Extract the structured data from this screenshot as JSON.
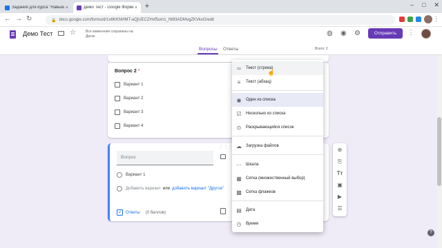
{
  "browser": {
    "tabs": [
      {
        "title": "Задания для курса \"Навыки Go",
        "favicon_color": "#1a73e8"
      },
      {
        "title": "Демо Тест - Google Формы",
        "favicon_color": "#673ab7"
      }
    ],
    "url": "docs.google.com/forms/d/1x6KKNHMT-aQjUECZHvf5um1_Nt93ADMvgZKVkxG/edit",
    "new_tab": "+",
    "close": "×"
  },
  "header": {
    "title": "Демо Тест",
    "saved_status": "Все изменения сохранены на Диске",
    "send_label": "Отправить",
    "tabs": {
      "questions": "Вопросы",
      "answers": "Ответы"
    },
    "total": "Всего: 2",
    "accent": "#673ab7"
  },
  "question2": {
    "title": "Вопрос 2",
    "required_mark": "*",
    "options": [
      "Вариант 1",
      "Вариант 2",
      "Вариант 3",
      "Вариант 4"
    ]
  },
  "new_question": {
    "placeholder": "Вопрос",
    "option1": "Вариант 1",
    "add_option": "Добавить вариант",
    "or": "или",
    "add_other": "добавить вариант \"Другое\"",
    "answers_label": "Ответы",
    "points": "(0 баллов)"
  },
  "menu": {
    "items": [
      {
        "label": "Текст (строка)",
        "icon": "short-text-icon"
      },
      {
        "label": "Текст (абзац)",
        "icon": "paragraph-icon"
      },
      {
        "label": "Один из списка",
        "icon": "radio-icon"
      },
      {
        "label": "Несколько из списка",
        "icon": "checkbox-icon"
      },
      {
        "label": "Раскрывающийся список",
        "icon": "dropdown-icon"
      },
      {
        "label": "Загрузка файлов",
        "icon": "upload-icon"
      },
      {
        "label": "Шкала",
        "icon": "scale-icon"
      },
      {
        "label": "Сетка (множественный выбор)",
        "icon": "grid-icon"
      },
      {
        "label": "Сетка флажков",
        "icon": "checkbox-grid-icon"
      },
      {
        "label": "Дата",
        "icon": "date-icon"
      },
      {
        "label": "Время",
        "icon": "time-icon"
      }
    ]
  }
}
